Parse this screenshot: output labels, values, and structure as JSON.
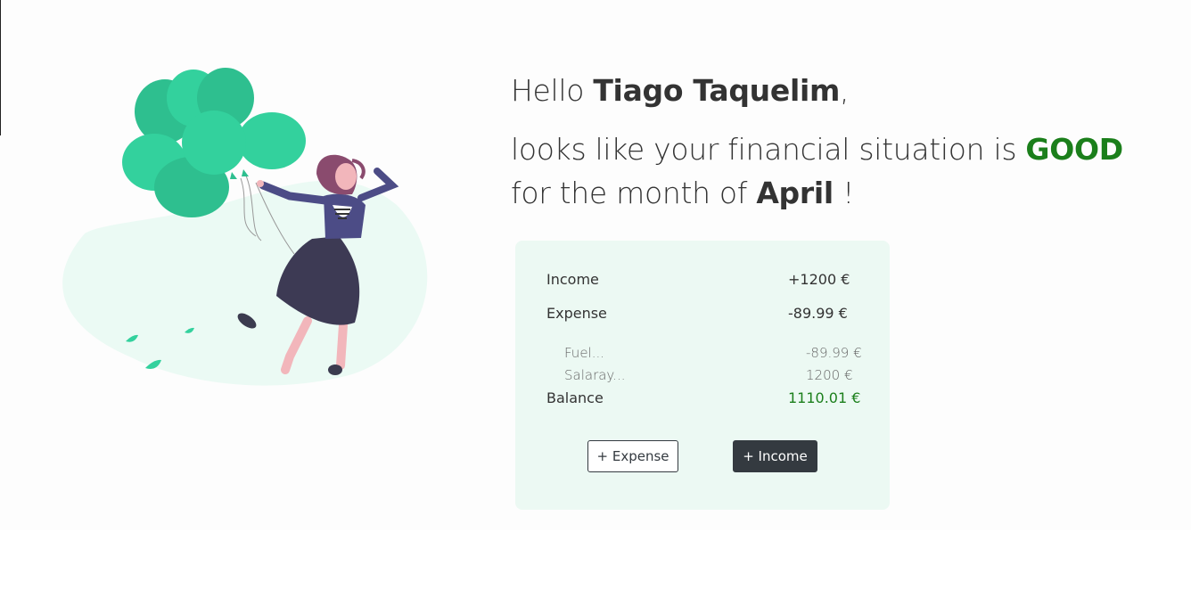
{
  "greeting": {
    "hello": "Hello ",
    "name": "Tiago Taquelim",
    "comma": ","
  },
  "situation": {
    "prefix": "looks like your financial situation is ",
    "status": "GOOD",
    "month_prefix": "for the month of ",
    "month": "April",
    "suffix": " !"
  },
  "summary": {
    "income_label": "Income",
    "income_value": "+1200 €",
    "expense_label": "Expense",
    "expense_value": "-89.99 €",
    "items": [
      {
        "label": "Fuel...",
        "value": "-89.99 €"
      },
      {
        "label": "Salaray...",
        "value": "1200 €"
      }
    ],
    "balance_label": "Balance",
    "balance_value": "1110.01 €"
  },
  "actions": {
    "add_expense": "+ Expense",
    "add_income": "+ Income"
  },
  "colors": {
    "good": "#1b7f1b",
    "card_bg": "#ecf9f3",
    "balloon": "#33d19d",
    "dark_button": "#343a40"
  },
  "illustration": {
    "icon": "woman-with-balloons-illustration"
  }
}
